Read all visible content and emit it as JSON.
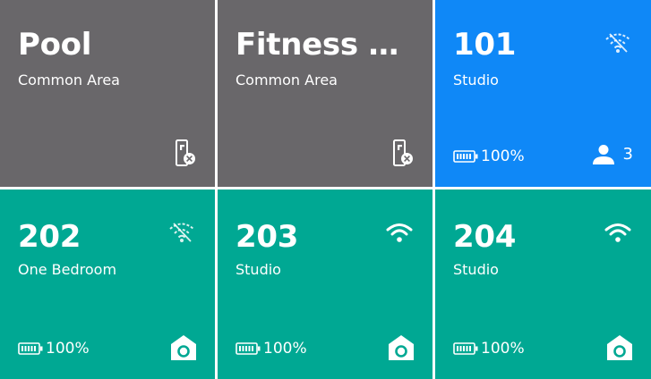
{
  "colors": {
    "common_area": "#69676a",
    "selected": "#0f88f7",
    "unit": "#00a893"
  },
  "tiles": [
    {
      "title": "Pool",
      "subtitle": "Common Area",
      "icons": [
        "smart-lock-icon"
      ]
    },
    {
      "title": "Fitness Ce...",
      "subtitle": "Common Area",
      "icons": [
        "smart-lock-icon"
      ]
    },
    {
      "title": "101",
      "subtitle": "Studio",
      "battery": "100%",
      "occupants": "3",
      "icons": [
        "wifi-off-icon",
        "battery-icon",
        "person-icon"
      ]
    },
    {
      "title": "202",
      "subtitle": "One Bedroom",
      "battery": "100%",
      "icons": [
        "wifi-off-icon",
        "battery-icon",
        "home-hub-icon"
      ]
    },
    {
      "title": "203",
      "subtitle": "Studio",
      "battery": "100%",
      "icons": [
        "wifi-icon",
        "battery-icon",
        "home-hub-icon"
      ]
    },
    {
      "title": "204",
      "subtitle": "Studio",
      "battery": "100%",
      "icons": [
        "wifi-icon",
        "battery-icon",
        "home-hub-icon"
      ]
    }
  ]
}
